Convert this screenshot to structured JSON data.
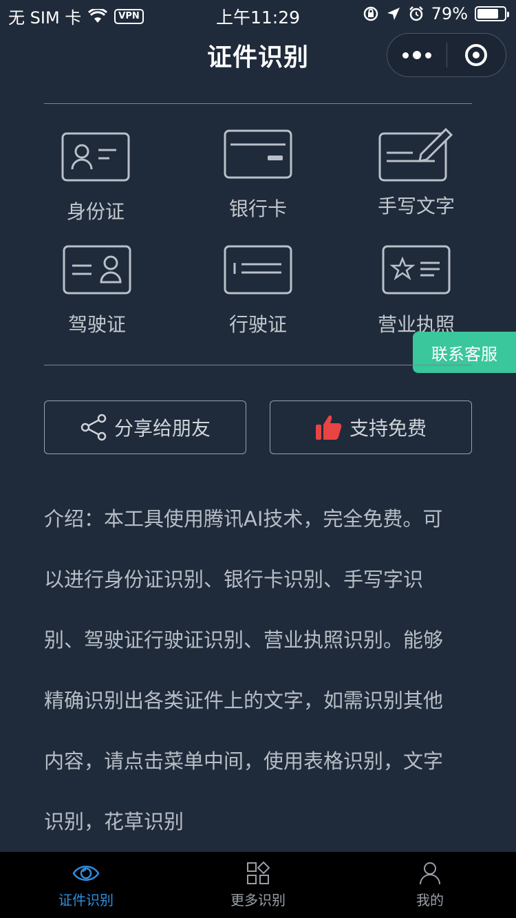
{
  "status_bar": {
    "carrier": "无 SIM 卡",
    "vpn": "VPN",
    "time": "上午11:29",
    "battery": "79%",
    "battery_level": 0.79
  },
  "nav": {
    "title": "证件识别"
  },
  "grid": [
    {
      "label": "身份证",
      "icon": "id-card-icon"
    },
    {
      "label": "银行卡",
      "icon": "bank-card-icon"
    },
    {
      "label": "手写文字",
      "icon": "handwriting-icon"
    },
    {
      "label": "驾驶证",
      "icon": "driver-license-icon"
    },
    {
      "label": "行驶证",
      "icon": "vehicle-license-icon"
    },
    {
      "label": "营业执照",
      "icon": "business-license-icon"
    }
  ],
  "contact": {
    "label": "联系客服"
  },
  "actions": {
    "share_label": "分享给朋友",
    "support_label": "支持免费"
  },
  "intro": {
    "lines": [
      "介绍：本工具使用腾讯AI技术，完全免费。可",
      "以进行身份证识别、银行卡识别、手写字识",
      "别、驾驶证行驶证识别、营业执照识别。能够",
      "精确识别出各类证件上的文字，如需识别其他",
      "内容，请点击菜单中间，使用表格识别，文字",
      "识别，花草识别"
    ]
  },
  "tabbar": {
    "tabs": [
      {
        "label": "证件识别",
        "active": true
      },
      {
        "label": "更多识别",
        "active": false
      },
      {
        "label": "我的",
        "active": false
      }
    ]
  },
  "colors": {
    "background": "#1f2a3a",
    "accent_green": "#39c79b",
    "tab_active": "#2f8fe0",
    "thumb_red": "#e84444"
  }
}
